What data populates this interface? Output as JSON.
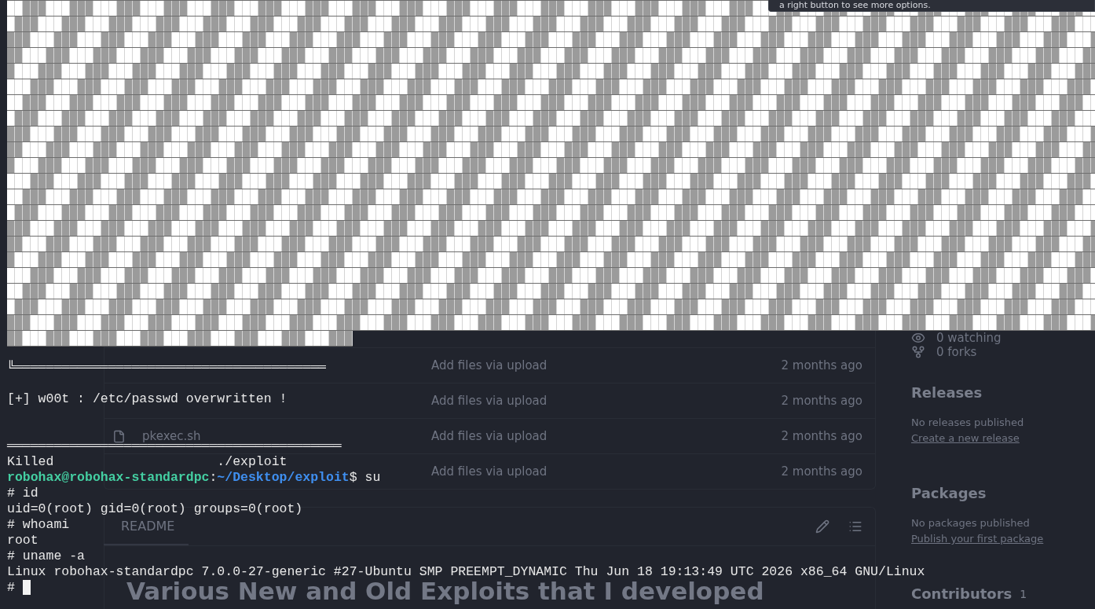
{
  "tooltip": {
    "text": "a right button to see more options."
  },
  "terminal": {
    "lines": [
      {
        "kind": "rule",
        "text": "╚════════════════════════════════════════"
      },
      {
        "kind": "blank"
      },
      {
        "kind": "text",
        "text": "[+] w00t : /etc/passwd overwritten !"
      },
      {
        "kind": "blank"
      },
      {
        "kind": "blank"
      },
      {
        "kind": "rule",
        "text": "═══════════════════════════════════════════"
      },
      {
        "kind": "text",
        "text": "Killed                     ./exploit"
      },
      {
        "kind": "prompt",
        "user_host": "robohax@robohax-standardpc",
        "separator": ":",
        "path": "~/Desktop/exploit",
        "symbol": "$",
        "command": "su"
      },
      {
        "kind": "text",
        "text": "# id"
      },
      {
        "kind": "text",
        "text": "uid=0(root) gid=0(root) groups=0(root)"
      },
      {
        "kind": "text",
        "text": "# whoami"
      },
      {
        "kind": "text",
        "text": "root"
      },
      {
        "kind": "text",
        "text": "# uname -a"
      },
      {
        "kind": "text",
        "text": "Linux robohax-standardpc 7.0.0-27-generic #27-Ubuntu SMP PREEMPT_DYNAMIC Thu Jun 18 19:13:49 UTC 2026 x86_64 GNU/Linux"
      },
      {
        "kind": "cursor",
        "text": "#"
      }
    ]
  },
  "repository": {
    "files": [
      {
        "message": "Add files via upload",
        "time": "2 months ago"
      },
      {
        "message": "Add files via upload",
        "time": "2 months ago"
      },
      {
        "name": "pkexec.sh",
        "message": "Add files via upload",
        "time": "2 months ago"
      },
      {
        "message": "Add files via upload",
        "time": "2 months ago"
      }
    ],
    "readme": {
      "tab": "README",
      "heading": "Various New and Old Exploits that I developed"
    },
    "sidebar": {
      "stats": [
        {
          "kind": "watching",
          "text": "0 watching"
        },
        {
          "kind": "forks",
          "text": "0 forks"
        }
      ],
      "sections": [
        {
          "title": "Releases",
          "text": "No releases published",
          "link": "Create a new release"
        },
        {
          "title": "Packages",
          "text": "No packages published",
          "link": "Publish your first package"
        },
        {
          "title": "Contributors",
          "count": "1"
        }
      ]
    }
  }
}
